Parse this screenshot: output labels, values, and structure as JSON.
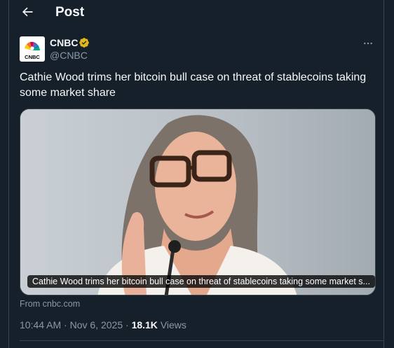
{
  "header": {
    "title": "Post"
  },
  "author": {
    "name": "CNBC",
    "handle": "@CNBC",
    "logo_text": "CNBC"
  },
  "post": {
    "text": "Cathie Wood trims her bitcoin bull case on threat of stablecoins taking some market share"
  },
  "card": {
    "caption": "Cathie Wood trims her bitcoin bull case on threat of stablecoins taking some market s...",
    "source": "From cnbc.com"
  },
  "meta": {
    "time": "10:44 AM",
    "separator": "·",
    "date": "Nov 6, 2025",
    "views_count": "18.1K",
    "views_label": "Views"
  },
  "colors": {
    "background": "#15202b",
    "text": "#f7f9f9",
    "secondary": "#8b98a5",
    "verified": "#e2b719",
    "border": "#38444d"
  },
  "icons": {
    "back": "arrow-left-icon",
    "verified": "verified-badge-icon",
    "more": "more-options-icon"
  }
}
